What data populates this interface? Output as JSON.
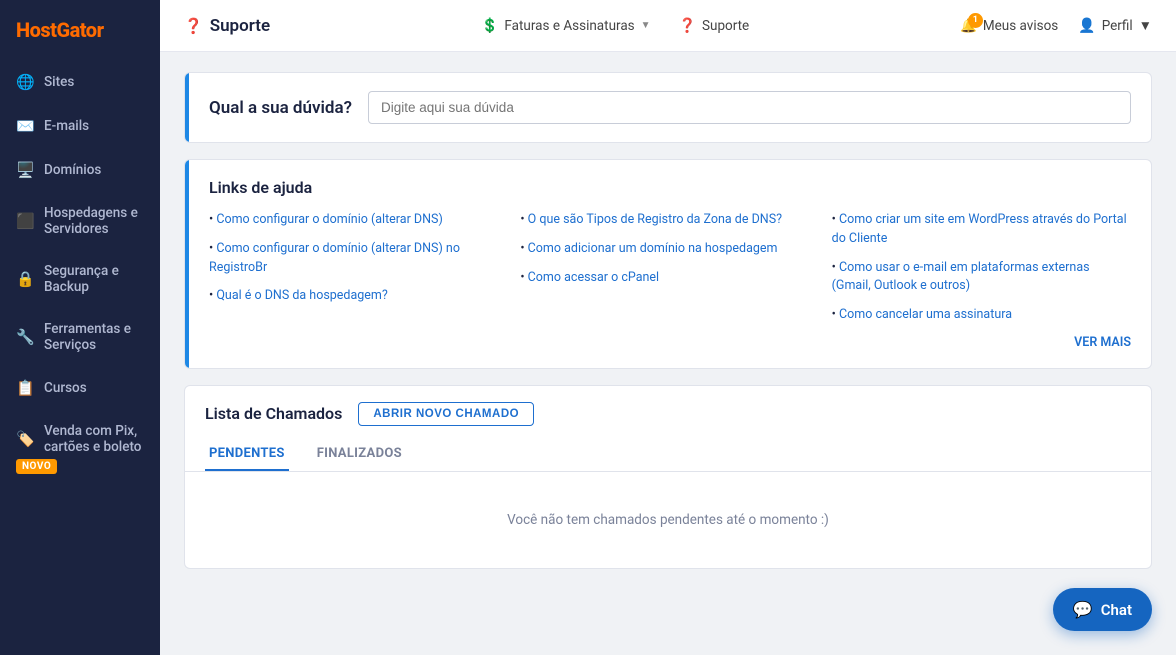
{
  "brand": {
    "name_part1": "Host",
    "name_part2": "Gator"
  },
  "sidebar": {
    "items": [
      {
        "id": "sites",
        "label": "Sites",
        "icon": "🌐"
      },
      {
        "id": "emails",
        "label": "E-mails",
        "icon": "✉️"
      },
      {
        "id": "dominios",
        "label": "Domínios",
        "icon": "🖥️"
      },
      {
        "id": "hospedagens",
        "label": "Hospedagens e Servidores",
        "icon": "⬛"
      },
      {
        "id": "seguranca",
        "label": "Segurança e Backup",
        "icon": "🔒"
      },
      {
        "id": "ferramentas",
        "label": "Ferramentas e Serviços",
        "icon": "🔧"
      },
      {
        "id": "cursos",
        "label": "Cursos",
        "icon": "📋"
      },
      {
        "id": "venda",
        "label": "Venda com Pix, cartões e boleto",
        "icon": "🏷️",
        "badge": "NOVO"
      }
    ]
  },
  "header": {
    "page_title": "Suporte",
    "nav": [
      {
        "id": "faturas",
        "label": "Faturas e Assinaturas",
        "has_dropdown": true
      },
      {
        "id": "suporte",
        "label": "Suporte",
        "has_dropdown": false
      }
    ],
    "right": [
      {
        "id": "avisos",
        "label": "Meus avisos",
        "icon": "bell",
        "badge": "1"
      },
      {
        "id": "perfil",
        "label": "Perfil",
        "has_dropdown": true
      }
    ]
  },
  "duvida": {
    "title": "Qual a sua dúvida?",
    "input_placeholder": "Digite aqui sua dúvida"
  },
  "links": {
    "section_title": "Links de ajuda",
    "items": [
      {
        "col": 0,
        "text": "Como configurar o domínio (alterar DNS)"
      },
      {
        "col": 0,
        "text": "Como configurar o domínio (alterar DNS) no RegistroBr"
      },
      {
        "col": 0,
        "text": "Qual é o DNS da hospedagem?"
      },
      {
        "col": 1,
        "text": "O que são Tipos de Registro da Zona de DNS?"
      },
      {
        "col": 1,
        "text": "Como adicionar um domínio na hospedagem"
      },
      {
        "col": 1,
        "text": "Como acessar o cPanel"
      },
      {
        "col": 2,
        "text": "Como criar um site em WordPress através do Portal do Cliente"
      },
      {
        "col": 2,
        "text": "Como usar o e-mail em plataformas externas (Gmail, Outlook e outros)"
      },
      {
        "col": 2,
        "text": "Como cancelar uma assinatura"
      }
    ],
    "ver_mais": "VER MAIS"
  },
  "chamados": {
    "title": "Lista de Chamados",
    "open_button": "ABRIR NOVO CHAMADO",
    "tabs": [
      {
        "id": "pendentes",
        "label": "PENDENTES",
        "active": true
      },
      {
        "id": "finalizados",
        "label": "FINALIZADOS",
        "active": false
      }
    ],
    "empty_message": "Você não tem chamados pendentes até o momento :)"
  },
  "chat": {
    "label": "Chat"
  }
}
